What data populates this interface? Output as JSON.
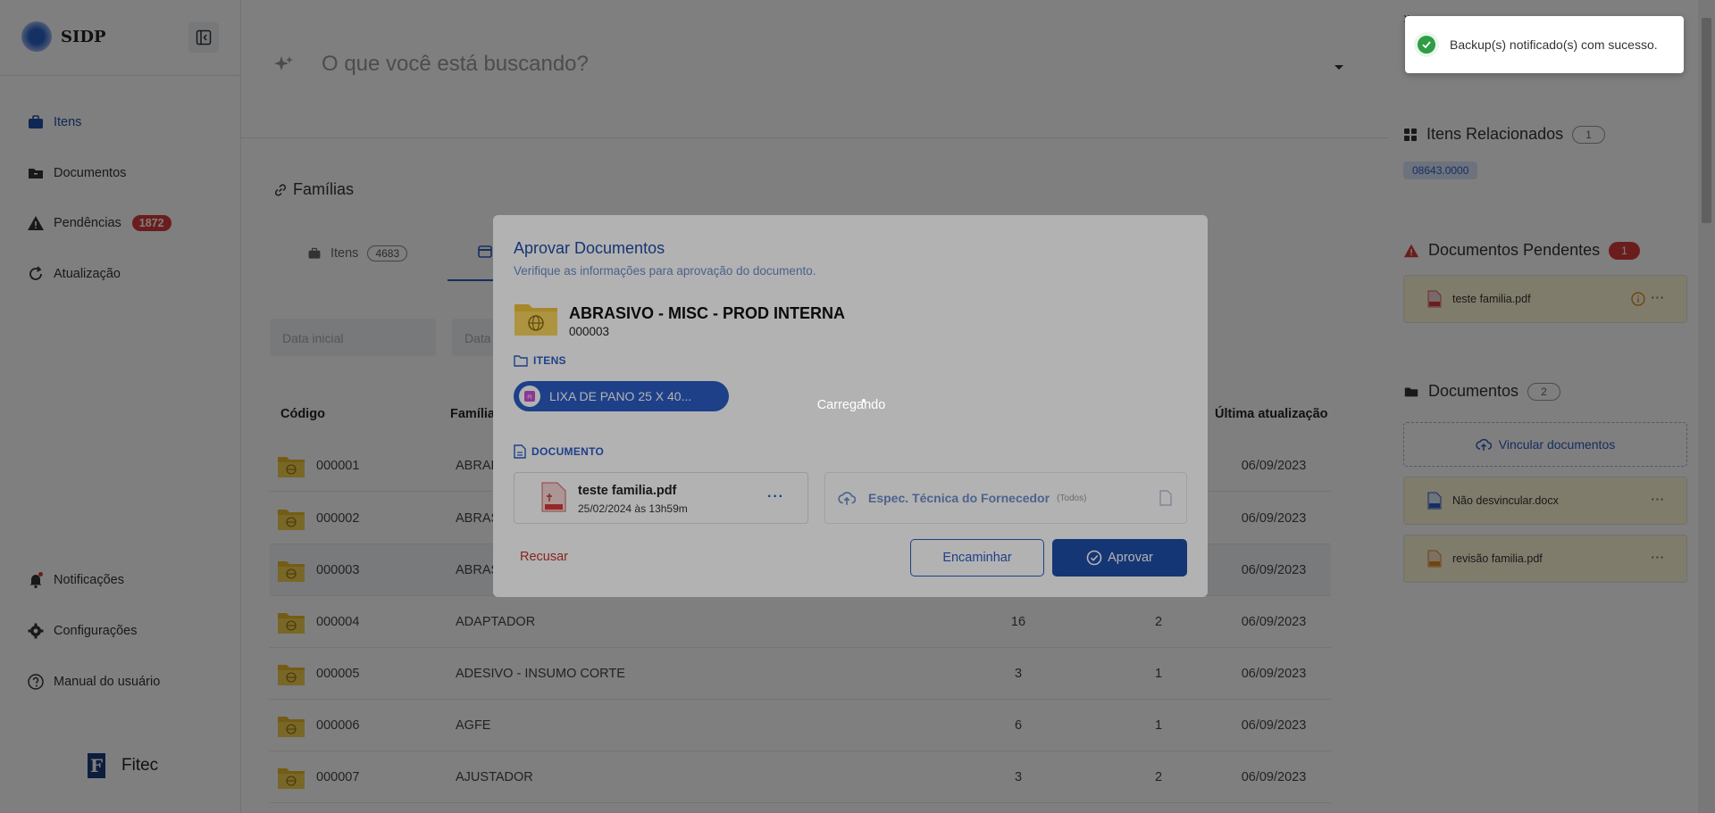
{
  "sidebar": {
    "brand": "SIDP",
    "items": [
      {
        "label": "Itens"
      },
      {
        "label": "Documentos"
      },
      {
        "label": "Pendências",
        "badge": "1872"
      },
      {
        "label": "Atualização"
      }
    ],
    "bottom": [
      {
        "label": "Notificações"
      },
      {
        "label": "Configurações"
      },
      {
        "label": "Manual do usuário"
      }
    ],
    "footer": "Fitec"
  },
  "search": {
    "placeholder": "O que você está buscando?"
  },
  "main": {
    "section_title": "Famílias",
    "tabs": [
      {
        "label": "Itens",
        "count": "4683"
      }
    ],
    "date_start_placeholder": "Data inicial",
    "date_end_placeholder": "Data",
    "columns": {
      "code": "Código",
      "family": "Família",
      "updated": "Última atualização"
    },
    "rows": [
      {
        "code": "000001",
        "family": "ABRAP",
        "n1": "",
        "n2": "",
        "date": "06/09/2023"
      },
      {
        "code": "000002",
        "family": "ABRAS",
        "n1": "",
        "n2": "",
        "date": "06/09/2023"
      },
      {
        "code": "000003",
        "family": "ABRAS",
        "n1": "",
        "n2": "",
        "date": "06/09/2023"
      },
      {
        "code": "000004",
        "family": "ADAPTADOR",
        "n1": "16",
        "n2": "2",
        "date": "06/09/2023"
      },
      {
        "code": "000005",
        "family": "ADESIVO - INSUMO CORTE",
        "n1": "3",
        "n2": "1",
        "date": "06/09/2023"
      },
      {
        "code": "000006",
        "family": "AGFE",
        "n1": "6",
        "n2": "1",
        "date": "06/09/2023"
      },
      {
        "code": "000007",
        "family": "AJUSTADOR",
        "n1": "3",
        "n2": "2",
        "date": "06/09/2023"
      }
    ]
  },
  "right_panel": {
    "related_title": "Itens Relacionados",
    "related_count": "1",
    "related_tag": "08643.0000",
    "pending_title": "Documentos Pendentes",
    "pending_count": "1",
    "pending_doc": "teste familia.pdf",
    "docs_title": "Documentos",
    "docs_count": "2",
    "link_label": "Vincular documentos",
    "docs": [
      "Não desvincular.docx",
      "revisão familia.pdf"
    ]
  },
  "toast": {
    "message": "Backup(s) notificado(s) com sucesso."
  },
  "modal": {
    "title": "Aprovar Documentos",
    "subtitle": "Verifique as informações para aprovação do documento.",
    "family_name": "ABRASIVO - MISC - PROD INTERNA",
    "family_code": "000003",
    "items_heading": "ITENS",
    "item_chip": "LIXA DE PANO 25 X 40...",
    "document_heading": "DOCUMENTO",
    "file_name": "teste familia.pdf",
    "file_date": "25/02/2024 às 13h59m",
    "upload_label": "Espec. Técnica do Fornecedor",
    "upload_sub": "(Todos)",
    "refuse": "Recusar",
    "forward": "Encaminhar",
    "approve": "Aprovar",
    "loading": "Carregando"
  },
  "colors": {
    "primary": "#1f4ea8",
    "danger": "#d63a3a",
    "success": "#2e9d46"
  }
}
